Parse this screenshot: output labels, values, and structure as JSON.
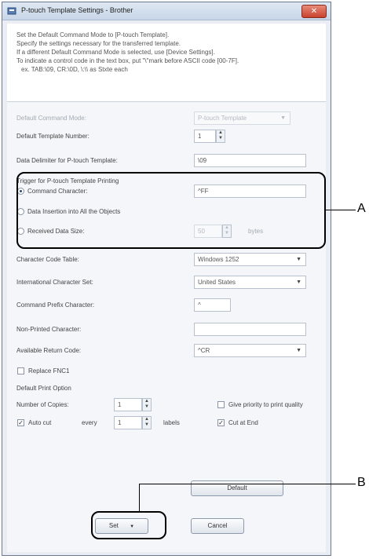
{
  "window": {
    "title": "P-touch Template Settings - Brother",
    "close_glyph": "✕"
  },
  "info": [
    "Set the Default Command Mode to [P-touch Template].",
    "Specify the settings necessary for the transferred template.",
    "If a different Default Command Mode is selected, use [Device Settings].",
    "To indicate a control code in the text box, put \"\\\"mark before ASCII code [00-7F].",
    "ex. TAB:\\09, CR:\\0D, \\:\\\\  as Stxte each"
  ],
  "default_command_mode": {
    "label": "Default Command Mode:",
    "value": "P-touch Template"
  },
  "default_template_number": {
    "label": "Default Template Number:",
    "value": "1"
  },
  "data_delimiter": {
    "label": "Data Delimiter for P-touch Template:",
    "value": "\\09"
  },
  "trigger": {
    "title": "Trigger for P-touch Template Printing",
    "command_character": {
      "label": "Command Character:",
      "value": "^FF",
      "selected": true
    },
    "data_insertion": {
      "label": "Data Insertion into All the Objects",
      "selected": false
    },
    "received_data_size": {
      "label": "Received Data Size:",
      "value": "50",
      "unit": "bytes",
      "selected": false
    }
  },
  "character_code_table": {
    "label": "Character Code Table:",
    "value": "Windows 1252"
  },
  "international_character_set": {
    "label": "International Character Set:",
    "value": "United States"
  },
  "command_prefix_character": {
    "label": "Command Prefix Character:",
    "value": "^"
  },
  "non_printed_character": {
    "label": "Non-Printed Character:",
    "value": ""
  },
  "available_return_code": {
    "label": "Available Return Code:",
    "value": "^CR"
  },
  "replace_fnc1": {
    "label": "Replace FNC1",
    "checked": false
  },
  "print_option": {
    "title": "Default Print Option",
    "copies_label": "Number of Copies:",
    "copies_value": "1",
    "auto_cut_label": "Auto cut",
    "auto_cut_checked": true,
    "every_label": "every",
    "every_value": "1",
    "labels_unit": "labels",
    "priority_label": "Give priority to print quality",
    "priority_checked": false,
    "cut_at_end_label": "Cut at End",
    "cut_at_end_checked": true
  },
  "buttons": {
    "default": "Default",
    "set": "Set",
    "set_arrow": "▼",
    "cancel": "Cancel"
  },
  "icons": {
    "spin_up": "▲",
    "spin_down": "▼",
    "dropdown": "▼",
    "check": "✓"
  },
  "callouts": {
    "a": "A",
    "b": "B"
  }
}
